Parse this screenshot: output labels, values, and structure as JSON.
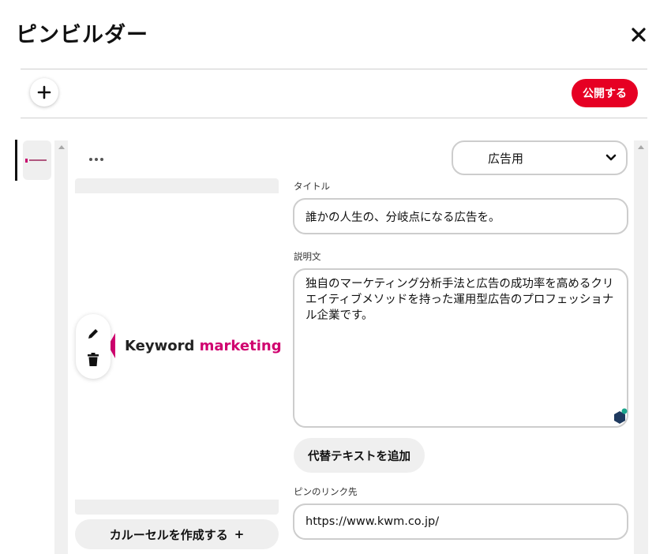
{
  "header": {
    "title": "ピンビルダー"
  },
  "toolbar": {
    "publish_label": "公開する"
  },
  "preview": {
    "logo_word1": "Keyword",
    "logo_word2": "marketing"
  },
  "carousel": {
    "label": "カルーセルを作成する",
    "icon_glyph": "+"
  },
  "form": {
    "board_select": "広告用",
    "title_label": "タイトル",
    "title_value": "誰かの人生の、分岐点になる広告を。",
    "description_label": "説明文",
    "description_value": "独自のマーケティング分析手法と広告の成功率を高めるクリエイティブメソッドを持った運用型広告のプロフェッショナル企業です。",
    "alt_text_button": "代替テキストを追加",
    "link_label": "ピンのリンク先",
    "link_value": "https://www.kwm.co.jp/"
  },
  "colors": {
    "brand": "#e60023",
    "logo_accent": "#d0006f"
  }
}
